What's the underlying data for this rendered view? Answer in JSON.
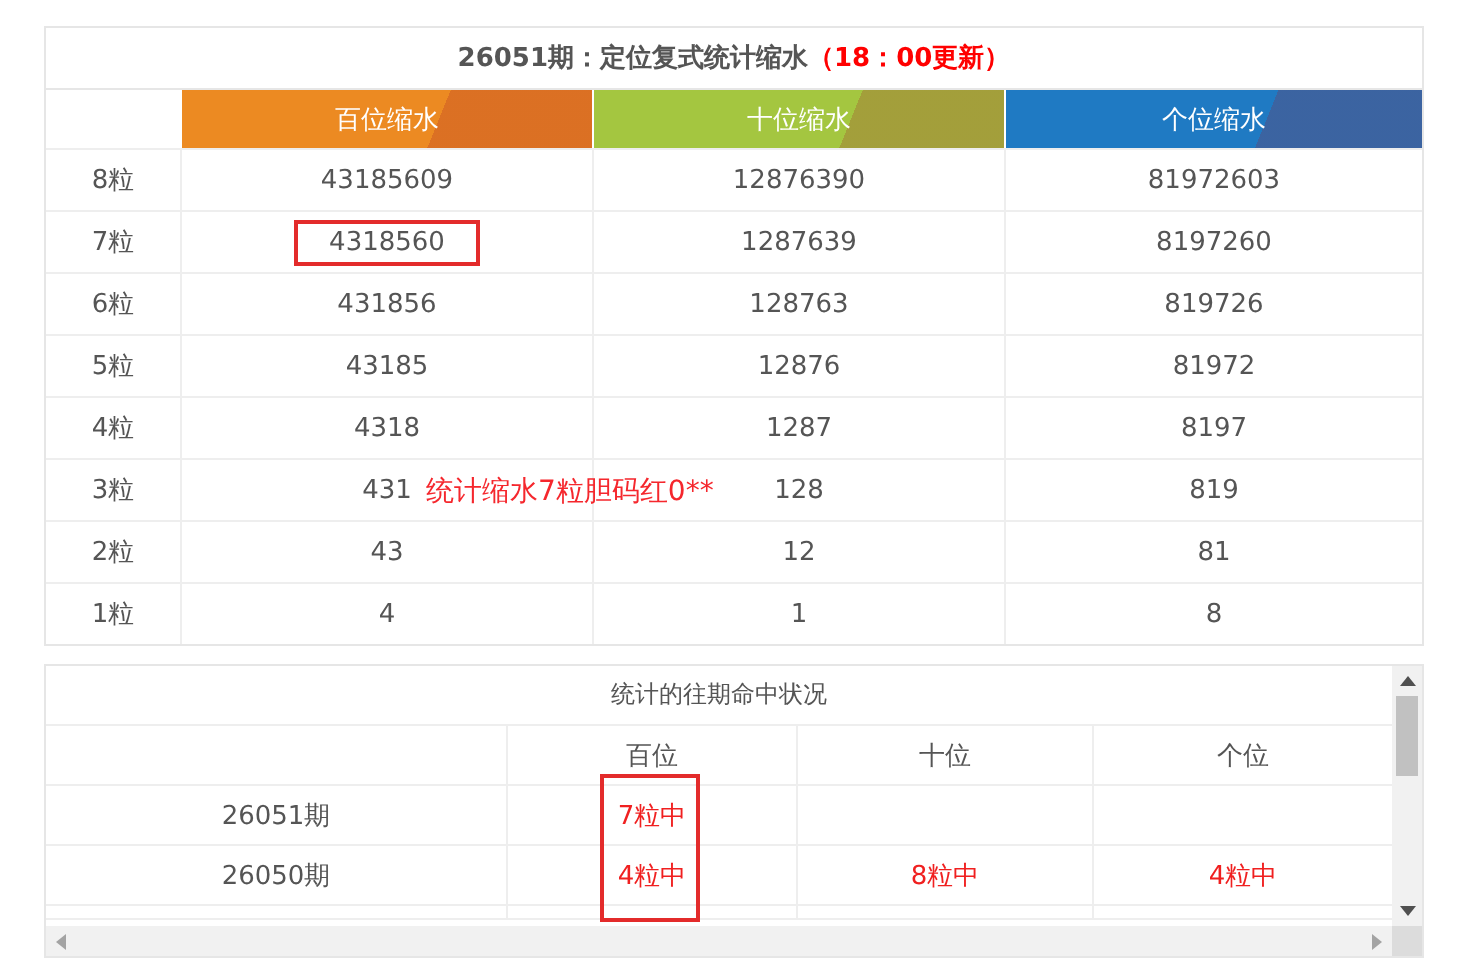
{
  "summary_table": {
    "title": "26051期：定位复式统计缩水",
    "title_note": "（18：00更新）",
    "columns": [
      {
        "label": "百位缩水",
        "color": "#ec8a22"
      },
      {
        "label": "十位缩水",
        "color": "#a4c640"
      },
      {
        "label": "个位缩水",
        "color": "#1f7ac3"
      }
    ],
    "rows": [
      {
        "label": "8粒",
        "cells": [
          {
            "text": "43185609",
            "circled": false
          },
          {
            "text": "12876390",
            "circled": false
          },
          {
            "text": "81972603",
            "circled": false
          }
        ]
      },
      {
        "label": "7粒",
        "cells": [
          {
            "text": "4318560",
            "circled": true
          },
          {
            "text": "1287639",
            "circled": false
          },
          {
            "text": "8197260",
            "circled": false
          }
        ]
      },
      {
        "label": "6粒",
        "cells": [
          {
            "text": "431856",
            "circled": false
          },
          {
            "text": "128763",
            "circled": false
          },
          {
            "text": "819726",
            "circled": false
          }
        ]
      },
      {
        "label": "5粒",
        "cells": [
          {
            "text": "43185",
            "circled": false
          },
          {
            "text": "12876",
            "circled": false
          },
          {
            "text": "81972",
            "circled": false
          }
        ]
      },
      {
        "label": "4粒",
        "cells": [
          {
            "text": "4318",
            "circled": false
          },
          {
            "text": "1287",
            "circled": false
          },
          {
            "text": "8197",
            "circled": false
          }
        ]
      },
      {
        "label": "3粒",
        "cells": [
          {
            "text": "431",
            "circled": false
          },
          {
            "text": "128",
            "circled": false
          },
          {
            "text": "819",
            "circled": false
          }
        ]
      },
      {
        "label": "2粒",
        "cells": [
          {
            "text": "43",
            "circled": false
          },
          {
            "text": "12",
            "circled": false
          },
          {
            "text": "81",
            "circled": false
          }
        ]
      },
      {
        "label": "1粒",
        "cells": [
          {
            "text": "4",
            "circled": false
          },
          {
            "text": "1",
            "circled": false
          },
          {
            "text": "8",
            "circled": false
          }
        ]
      }
    ],
    "overlay_note": "统计缩水7粒胆码红0**"
  },
  "history_table": {
    "caption": "统计的往期命中状况",
    "columns": [
      {
        "label": "百位",
        "circled": true
      },
      {
        "label": "十位",
        "circled": false
      },
      {
        "label": "个位",
        "circled": false
      }
    ],
    "rows": [
      {
        "period": "26051期",
        "hundreds": "7粒中"
      },
      {
        "period": "26050期",
        "hundreds": "4粒中",
        "tens": "8粒中",
        "ones": "4粒中"
      }
    ]
  }
}
